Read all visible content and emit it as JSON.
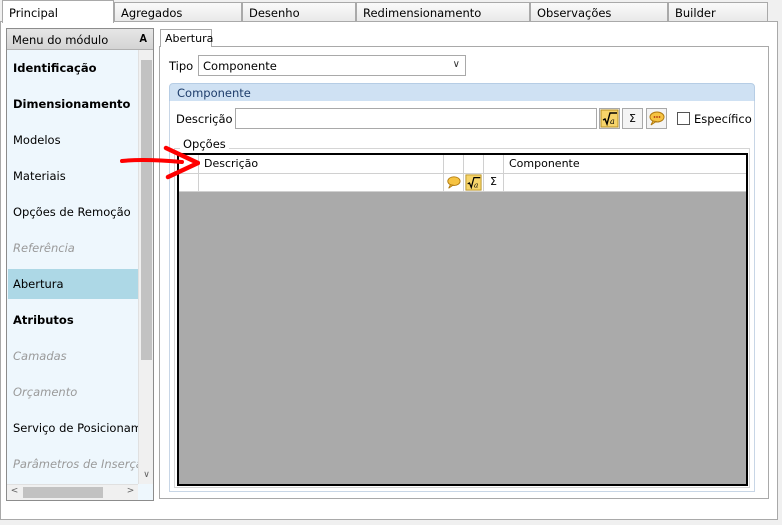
{
  "top_tabs": [
    "Principal",
    "Agregados",
    "Desenho",
    "Redimensionamento",
    "Observações",
    "Builder"
  ],
  "sidebar": {
    "title": "Menu do módulo",
    "items": [
      {
        "label": "Identificação",
        "style": "bold"
      },
      {
        "label": "Dimensionamento",
        "style": "bold"
      },
      {
        "label": "Modelos",
        "style": "normal"
      },
      {
        "label": "Materiais",
        "style": "normal"
      },
      {
        "label": "Opções de Remoção",
        "style": "normal"
      },
      {
        "label": "Referência",
        "style": "disabled"
      },
      {
        "label": "Abertura",
        "style": "selected"
      },
      {
        "label": "Atributos",
        "style": "bold"
      },
      {
        "label": "Camadas",
        "style": "disabled"
      },
      {
        "label": "Orçamento",
        "style": "disabled"
      },
      {
        "label": "Serviço de Posicionamen",
        "style": "normal"
      },
      {
        "label": "Parâmetros de Inserção",
        "style": "disabled"
      }
    ]
  },
  "content": {
    "tab_label": "Abertura",
    "tipo_label": "Tipo",
    "tipo_value": "Componente",
    "group_title": "Componente",
    "descricao_label": "Descrição",
    "descricao_value": "",
    "especifico_label": "Específico",
    "opcoes_label": "Opções",
    "grid": {
      "columns": [
        "Descrição",
        "Componente"
      ]
    }
  },
  "colors": {
    "selected_item": "#add8e6",
    "group_header": "#cfe1f3",
    "grid_empty": "#aaaaaa",
    "arrow": "#ff0000"
  }
}
